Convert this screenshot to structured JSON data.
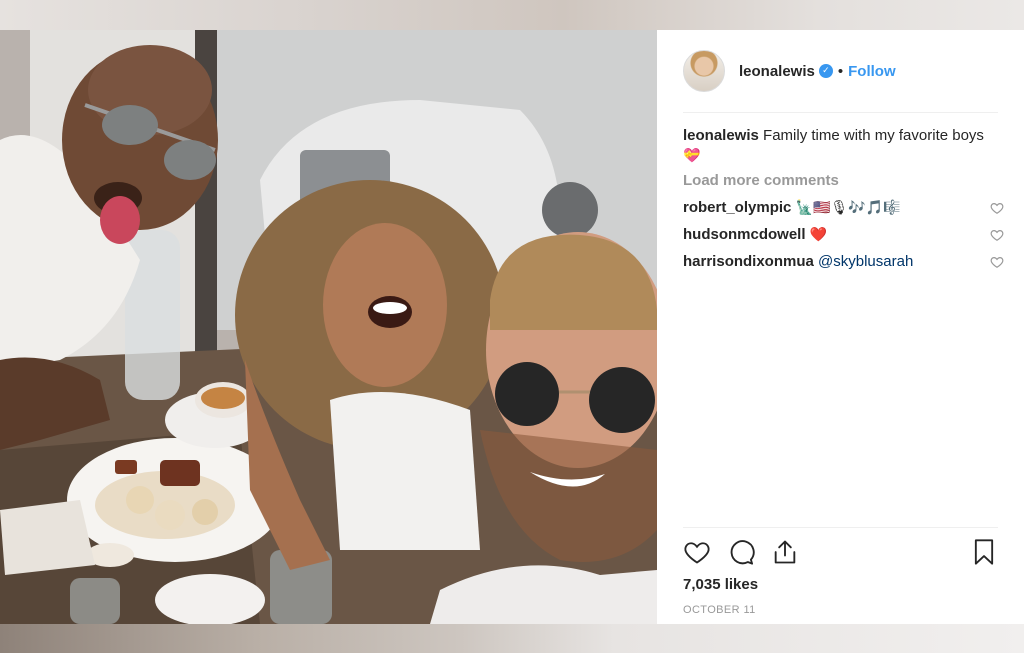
{
  "post": {
    "username": "leonalewis",
    "verified_icon": "verified-badge-icon",
    "separator": "•",
    "follow_label": "Follow",
    "caption_text": "Family time with my favorite boys",
    "caption_emoji": "💝",
    "load_more_label": "Load more comments",
    "comments": [
      {
        "user": "robert_olympic",
        "text": "🗽🇺🇸🎙🎶🎵🎼",
        "mention": ""
      },
      {
        "user": "hudsonmcdowell",
        "text": "❤️",
        "mention": ""
      },
      {
        "user": "harrisondixonmua",
        "text": "",
        "mention": "@skyblusarah"
      }
    ],
    "likes": "7,035 likes",
    "date": "OCTOBER 11"
  },
  "colors": {
    "accent": "#3897f0",
    "text": "#262626",
    "muted": "#999999",
    "mention": "#003569"
  },
  "icons": {
    "like": "heart-icon",
    "comment": "comment-icon",
    "share": "share-icon",
    "save": "bookmark-icon"
  }
}
